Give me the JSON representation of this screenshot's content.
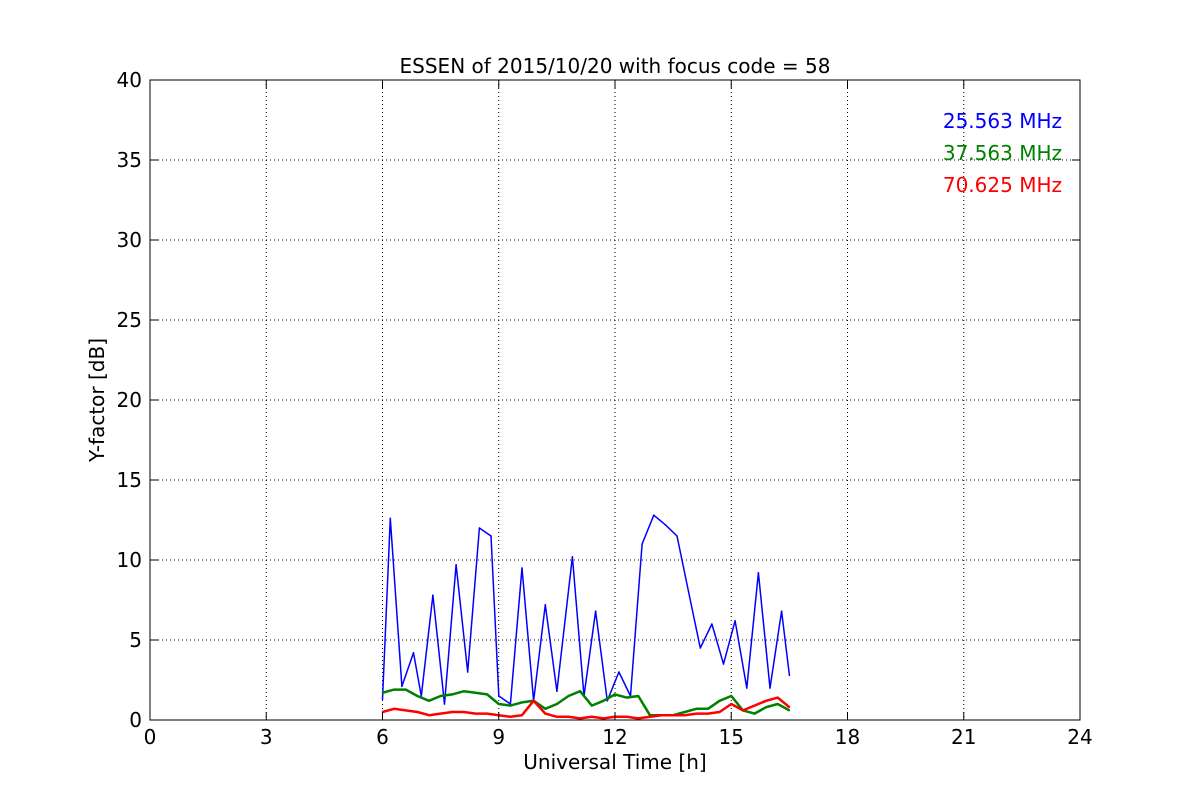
{
  "chart_data": {
    "type": "line",
    "title": "ESSEN of 2015/10/20 with focus code = 58",
    "xlabel": "Universal Time [h]",
    "ylabel": "Y-factor [dB]",
    "xlim": [
      0,
      24
    ],
    "ylim": [
      0,
      40
    ],
    "xticks": [
      0,
      3,
      6,
      9,
      12,
      15,
      18,
      21,
      24
    ],
    "yticks": [
      0,
      5,
      10,
      15,
      20,
      25,
      30,
      35,
      40
    ],
    "xtick_labels": [
      "0",
      "3",
      "6",
      "9",
      "12",
      "15",
      "18",
      "21",
      "24"
    ],
    "ytick_labels": [
      "0",
      "5",
      "10",
      "15",
      "20",
      "25",
      "30",
      "35",
      "40"
    ],
    "grid": true,
    "legend_placement": "top-right",
    "series": [
      {
        "name": "25.563 MHz",
        "color": "#0000ff",
        "x": [
          6.0,
          6.2,
          6.5,
          6.8,
          7.0,
          7.3,
          7.6,
          7.9,
          8.2,
          8.5,
          8.8,
          9.0,
          9.3,
          9.6,
          9.9,
          10.2,
          10.5,
          10.9,
          11.2,
          11.5,
          11.8,
          12.1,
          12.4,
          12.7,
          13.0,
          13.3,
          13.6,
          13.9,
          14.2,
          14.5,
          14.8,
          15.1,
          15.4,
          15.7,
          16.0,
          16.3,
          16.5
        ],
        "y": [
          1.3,
          12.6,
          2.1,
          4.2,
          1.5,
          7.8,
          1.0,
          9.7,
          3.0,
          12.0,
          11.5,
          1.5,
          1.0,
          9.5,
          1.2,
          7.2,
          1.8,
          10.2,
          1.5,
          6.8,
          1.2,
          3.0,
          1.5,
          11.0,
          12.8,
          12.2,
          11.5,
          8.0,
          4.5,
          6.0,
          3.5,
          6.2,
          2.0,
          9.2,
          2.0,
          6.8,
          2.8
        ]
      },
      {
        "name": "37.563 MHz",
        "color": "#008000",
        "x": [
          6.0,
          6.3,
          6.6,
          6.9,
          7.2,
          7.5,
          7.8,
          8.1,
          8.4,
          8.7,
          9.0,
          9.3,
          9.6,
          9.9,
          10.2,
          10.5,
          10.8,
          11.1,
          11.4,
          11.7,
          12.0,
          12.3,
          12.6,
          12.9,
          13.2,
          13.5,
          13.8,
          14.1,
          14.4,
          14.7,
          15.0,
          15.3,
          15.6,
          15.9,
          16.2,
          16.5
        ],
        "y": [
          1.7,
          1.9,
          1.9,
          1.5,
          1.2,
          1.5,
          1.6,
          1.8,
          1.7,
          1.6,
          1.0,
          0.9,
          1.1,
          1.2,
          0.7,
          1.0,
          1.5,
          1.8,
          0.9,
          1.2,
          1.6,
          1.4,
          1.5,
          0.3,
          0.3,
          0.3,
          0.5,
          0.7,
          0.7,
          1.2,
          1.5,
          0.6,
          0.4,
          0.8,
          1.0,
          0.6
        ]
      },
      {
        "name": "70.625 MHz",
        "color": "#ff0000",
        "x": [
          6.0,
          6.3,
          6.6,
          6.9,
          7.2,
          7.5,
          7.8,
          8.1,
          8.4,
          8.7,
          9.0,
          9.3,
          9.6,
          9.9,
          10.2,
          10.5,
          10.8,
          11.1,
          11.4,
          11.7,
          12.0,
          12.3,
          12.6,
          12.9,
          13.2,
          13.5,
          13.8,
          14.1,
          14.4,
          14.7,
          15.0,
          15.3,
          15.6,
          15.9,
          16.2,
          16.5
        ],
        "y": [
          0.5,
          0.7,
          0.6,
          0.5,
          0.3,
          0.4,
          0.5,
          0.5,
          0.4,
          0.4,
          0.3,
          0.2,
          0.3,
          1.2,
          0.4,
          0.2,
          0.2,
          0.1,
          0.2,
          0.1,
          0.2,
          0.2,
          0.1,
          0.2,
          0.3,
          0.3,
          0.3,
          0.4,
          0.4,
          0.5,
          1.0,
          0.6,
          0.9,
          1.2,
          1.4,
          0.8
        ]
      }
    ]
  }
}
